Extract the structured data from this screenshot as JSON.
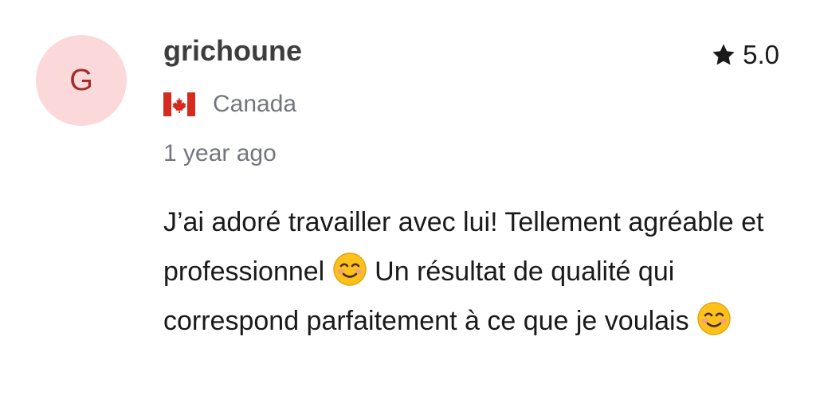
{
  "review": {
    "avatar_initial": "G",
    "username": "grichoune",
    "rating": "5.0",
    "country": "Canada",
    "country_flag_icon": "canada-flag-icon",
    "time_ago": "1 year ago",
    "text_parts": [
      "J’ai adoré travailler avec lui! Tellement agréable et professionnel",
      "Un résultat de qualité qui correspond parfaitement à ce que je voulais"
    ],
    "emoji_icon": "smiling-face-emoji"
  },
  "colors": {
    "avatar_bg": "#fbd9da",
    "avatar_letter": "#a52a2a",
    "username": "#3d3d3d",
    "meta_gray": "#74767e",
    "text": "#1a1a1a"
  }
}
